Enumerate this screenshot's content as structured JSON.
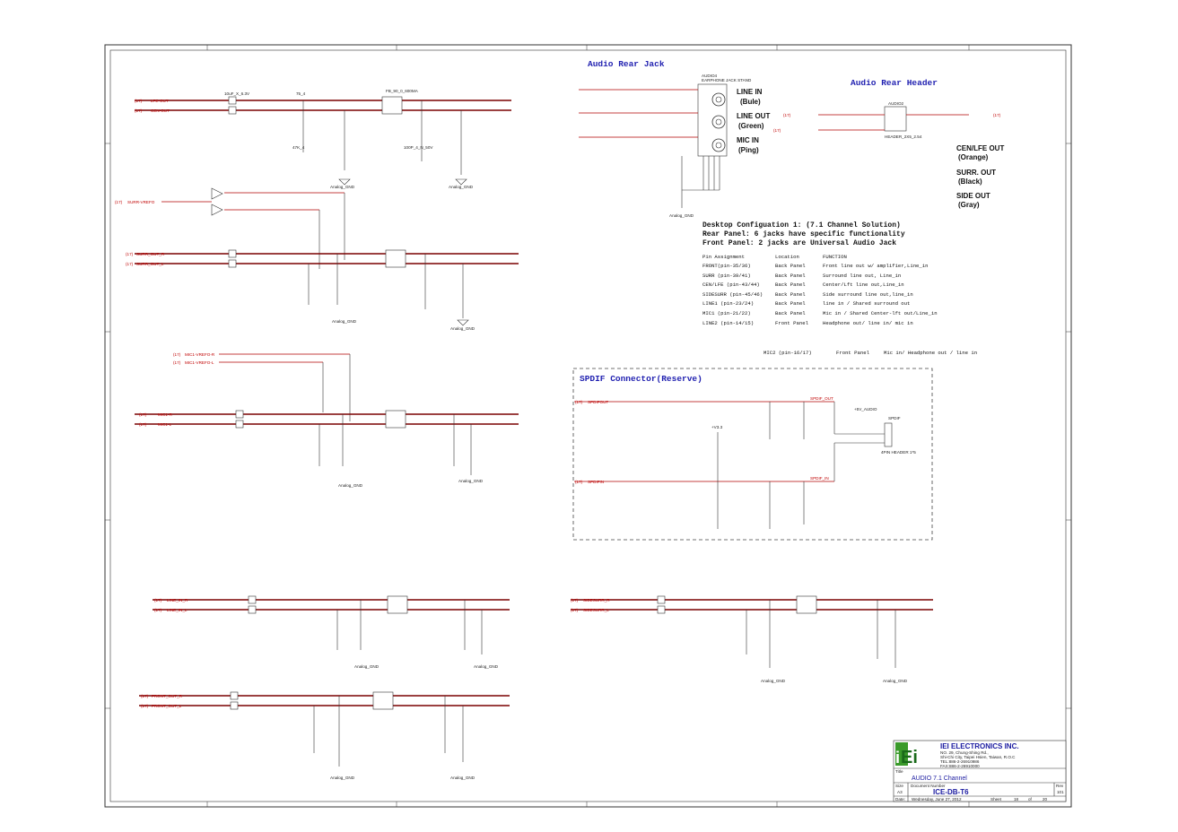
{
  "titles": {
    "rear_jack": "Audio Rear Jack",
    "rear_header": "Audio Rear Header",
    "spdif": "SPDIF Connector(Reserve)"
  },
  "jack_part": {
    "ref": "AUDIO4",
    "part": "EARPHONE JACK STAND"
  },
  "jack_labels": [
    "LINE IN",
    "(Bule)",
    "LINE OUT",
    "(Green)",
    "MIC IN",
    "(Ping)"
  ],
  "header_part": {
    "ref": "AUDIO2",
    "part": "HEADER_2X5_2.54"
  },
  "header_notes": [
    "CEN/LFE OUT",
    "(Orange)",
    "SURR. OUT",
    "(Black)",
    "SIDE OUT",
    "(Gray)"
  ],
  "config": {
    "heading": "Desktop Configuation 1: (7.1 Channel Solution)",
    "rear_note": "Rear Panel: 6 jacks have specific functionality",
    "front_note": "Front Panel: 2 jacks are Universal Audio Jack",
    "columns": [
      "Pin Assignment",
      "Location",
      "FUNCTION"
    ],
    "rows": [
      [
        "FRONT(pin-35/36)",
        "Back Panel",
        "Front line out w/ amplifier,Line_in"
      ],
      [
        "SURR (pin-39/41)",
        "Back Panel",
        "Surround line out, Line_in"
      ],
      [
        "CEN/LFE (pin-43/44)",
        "Back Panel",
        "Center/Lft line out,Line_in"
      ],
      [
        "SIDESURR (pin-45/46)",
        "Back Panel",
        "Side surround line out,line_in"
      ],
      [
        "LINE1 (pin-23/24)",
        "Back Panel",
        "line in / Shared surround out"
      ],
      [
        "MIC1 (pin-21/22)",
        "Back Panel",
        "Mic in / Shared Center-lft out/Line_in"
      ],
      [
        "LINE2 (pin-14/15)",
        "Front Panel",
        "Headphone out/ line in/ mic in"
      ]
    ],
    "mic2_row": [
      "MIC2 (pin-16/17)",
      "Front Panel",
      "Mic in/ Headphone out / line in"
    ]
  },
  "nets": {
    "lfe_out": "LFE-OUT",
    "cen_out": "CEN-OUT",
    "surr_vrefo": "SURR-VREFO",
    "surr_out_r": "SURR_OUT_R",
    "surr_out_l": "SURR_OUT_L",
    "mic1_vrefo_r": "MIC1-VREFO-R",
    "mic1_vrefo_l": "MIC1-VREFO-L",
    "mic1_r": "MIC1-R",
    "mic1_l": "MIC1-L",
    "line_in_r": "LINE_IN_R",
    "line_in_l": "LINE_IN_L",
    "front_out_r": "FRONT_OUT_R",
    "front_out_l": "FRONT_OUT_L",
    "sidesurr_r": "SIDESURR_R",
    "sidesurr_l": "SIDESURR_L",
    "spdifout": "SPDIFOUT",
    "spdifin": "SPDIFIN",
    "analog_gnd": "Analog_GND",
    "sheet_ref": "(17)"
  },
  "parts": {
    "cap_10uf": "10uF_X_6.3V",
    "res_75": "75_4",
    "res_47k": "47K_4",
    "fb": "FB_90_0_600MA",
    "cap_100p": "100P_4_N_50V"
  },
  "spdif": {
    "header": "SPDIF",
    "header_part": "4PIN HEADER 1*5",
    "supply": "+5V_AUDIO",
    "v33": "+V3.3",
    "out_label": "SPDIF_OUT",
    "in_label": "SPDIF_IN"
  },
  "titleblock": {
    "company": "IEI ELECTRONICS INC.",
    "address": [
      "NO. 29, Chung-Shing Rd.,",
      "Shi-Chi City, Taipei Hsien, Taiwan, R.O.C",
      "TEL:886-2-26910986",
      "FAX:886-2-26910000"
    ],
    "title_label": "Title",
    "title": "AUDIO 7.1 Channel",
    "size_label": "Size",
    "size": "A3",
    "doc_label": "Document Number",
    "doc": "ICE-DB-T6",
    "rev_label": "Rev",
    "rev": "101",
    "date_label": "Date:",
    "date": "Wednesday, June 27, 2012",
    "sheet_label": "Sheet",
    "sheet": "18",
    "of_label": "of",
    "total": "20"
  }
}
